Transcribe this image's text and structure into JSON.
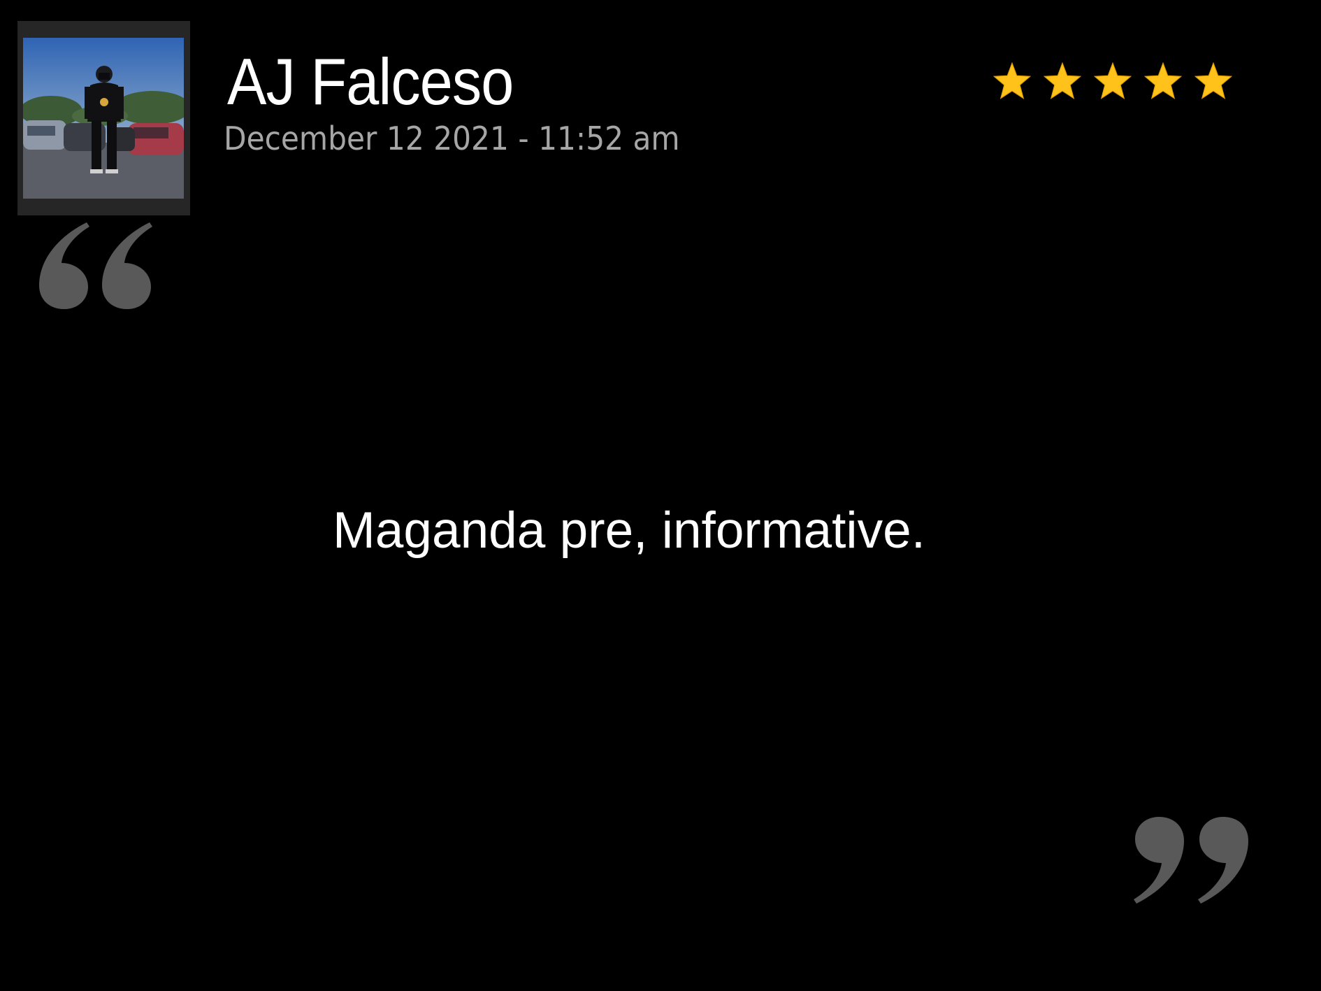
{
  "review": {
    "reviewer_name": "AJ Falceso",
    "date": "December 12 2021 - 11:52 am",
    "rating": 5,
    "rating_max": 5,
    "text": "Maganda pre, informative."
  },
  "avatar": {
    "icon": "reviewer-photo"
  },
  "colors": {
    "background": "#000000",
    "name": "#ffffff",
    "date": "#a6a6a6",
    "star": "#ffc21a",
    "quote_marks": "#595959"
  }
}
